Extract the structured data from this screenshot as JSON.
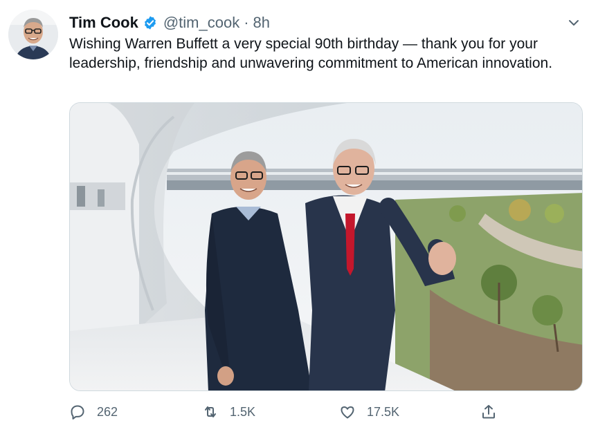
{
  "tweet": {
    "author_name": "Tim Cook",
    "handle": "@tim_cook",
    "separator": "·",
    "time": "8h",
    "text": "Wishing Warren Buffett a very special 90th birthday — thank you for your leadership, friendship and unwavering commitment to American innovation."
  },
  "actions": {
    "reply_count": "262",
    "retweet_count": "1.5K",
    "like_count": "17.5K"
  },
  "colors": {
    "verified": "#1d9bf0",
    "secondary_text": "#536471",
    "primary_text": "#0f1419"
  },
  "icons": [
    "verified-badge-icon",
    "chevron-down-icon",
    "reply-icon",
    "retweet-icon",
    "like-icon",
    "share-icon"
  ]
}
